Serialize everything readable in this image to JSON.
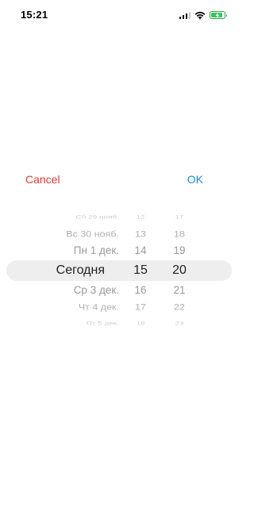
{
  "status_bar": {
    "time": "15:21",
    "battery_color": "#34c759"
  },
  "toolbar": {
    "cancel_label": "Cancel",
    "ok_label": "OK",
    "cancel_color": "#e53935",
    "ok_color": "#1e88e5"
  },
  "picker": {
    "rows": [
      {
        "date": "Сб 29 нояб.",
        "hour": "12",
        "minute": "17"
      },
      {
        "date": "Вс 30 нояб.",
        "hour": "13",
        "minute": "18"
      },
      {
        "date": "Пн 1 дек.",
        "hour": "14",
        "minute": "19"
      },
      {
        "date": "Сегодня",
        "hour": "15",
        "minute": "20"
      },
      {
        "date": "Ср 3 дек.",
        "hour": "16",
        "minute": "21"
      },
      {
        "date": "Чт 4 дек.",
        "hour": "17",
        "minute": "22"
      },
      {
        "date": "Пт 5 дек.",
        "hour": "18",
        "minute": "23"
      }
    ],
    "selected_index": 3
  }
}
